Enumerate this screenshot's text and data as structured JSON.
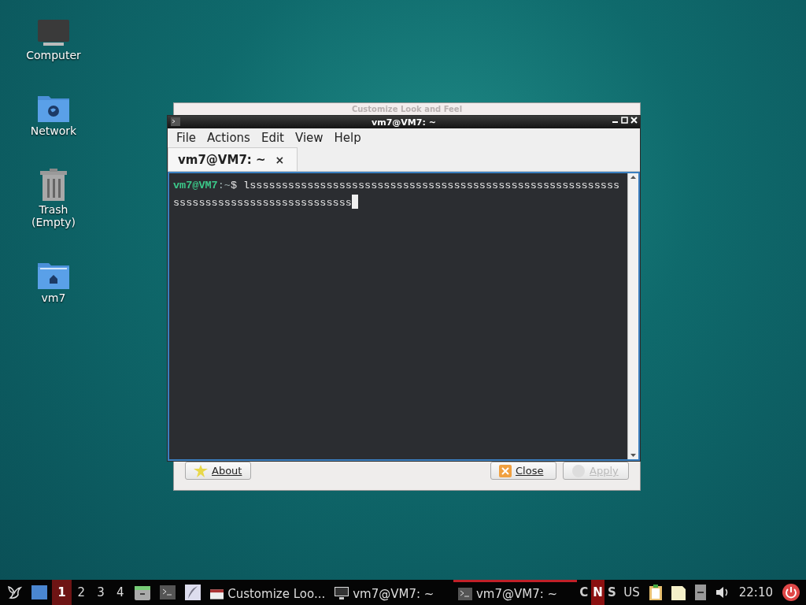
{
  "desktop_icons": [
    {
      "label": "Computer",
      "kind": "computer"
    },
    {
      "label": "Network",
      "kind": "network"
    },
    {
      "label": "Trash\n(Empty)",
      "kind": "trash"
    },
    {
      "label": "vm7",
      "kind": "home"
    }
  ],
  "background_window": {
    "title": "Customize Look and Feel",
    "buttons": [
      {
        "label": "About",
        "kind": "about",
        "disabled": false
      },
      {
        "label": "Close",
        "kind": "close",
        "disabled": false
      },
      {
        "label": "Apply",
        "kind": "apply",
        "disabled": true
      }
    ]
  },
  "terminal": {
    "title": "vm7@VM7: ~",
    "menu": [
      "File",
      "Actions",
      "Edit",
      "View",
      "Help"
    ],
    "tabs": [
      {
        "label": "vm7@VM7: ~",
        "close": "×",
        "selected": true
      }
    ],
    "prompt": {
      "user_host": "vm7@VM7",
      "path": ":~",
      "symbol": "$"
    },
    "command": "lssssssssssssssssssssssssssssssssssssssssssssssssssssssssssssssssssssssssssssssssssssss"
  },
  "taskbar": {
    "workspaces": [
      {
        "label": "1",
        "selected": true
      },
      {
        "label": "2",
        "selected": false
      },
      {
        "label": "3",
        "selected": false
      },
      {
        "label": "4",
        "selected": false
      }
    ],
    "tasks": [
      {
        "label": "Customize Loo...",
        "kind": "dialog",
        "selected": false
      },
      {
        "label": "vm7@VM7: ~",
        "kind": "monitor",
        "selected": false
      },
      {
        "label": "vm7@VM7: ~",
        "kind": "terminal",
        "selected": true
      }
    ],
    "indicators": [
      {
        "label": "C",
        "selected": false
      },
      {
        "label": "N",
        "selected": true
      },
      {
        "label": "S",
        "selected": false
      }
    ],
    "keyboard_layout": "US",
    "clock": "22:10"
  }
}
